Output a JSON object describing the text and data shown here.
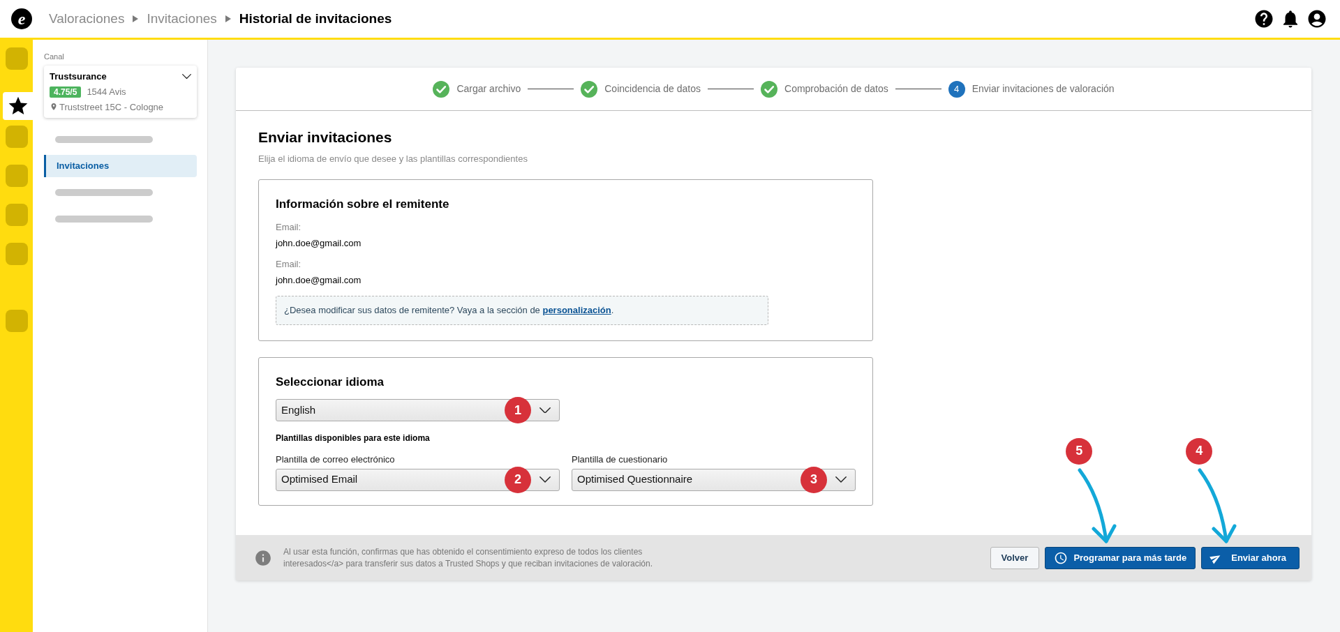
{
  "header": {
    "logo_letter": "e",
    "breadcrumb": [
      {
        "label": "Valoraciones",
        "current": false
      },
      {
        "label": "Invitaciones",
        "current": false
      },
      {
        "label": "Historial de invitaciones",
        "current": true
      }
    ]
  },
  "rail": [
    {
      "kind": "blank",
      "selected": false
    },
    {
      "kind": "star",
      "selected": true
    },
    {
      "kind": "blank",
      "selected": false
    },
    {
      "kind": "blank",
      "selected": false
    },
    {
      "kind": "blank",
      "selected": false
    },
    {
      "kind": "blank",
      "selected": false
    },
    {
      "kind": "gap"
    },
    {
      "kind": "blank",
      "selected": false
    }
  ],
  "channel": {
    "label": "Canal",
    "name": "Trustsurance",
    "rating": "4.75/5",
    "reviews": "1544 Avis",
    "address": "Truststreet 15C - Cologne"
  },
  "nav": [
    {
      "kind": "skeleton"
    },
    {
      "kind": "item",
      "label": "Invitaciones",
      "selected": true
    },
    {
      "kind": "skeleton"
    },
    {
      "kind": "skeleton"
    }
  ],
  "steps": [
    {
      "label": "Cargar archivo",
      "completed": true
    },
    {
      "label": "Coincidencia de datos",
      "completed": true
    },
    {
      "label": "Comprobación de datos",
      "completed": true
    },
    {
      "label": "Enviar invitaciones de valoración",
      "completed": false,
      "number": "4"
    }
  ],
  "page": {
    "title": "Enviar invitaciones",
    "subtitle": "Elija el idioma de envío que desee y las plantillas correspondientes"
  },
  "sender": {
    "title": "Información sobre el remitente",
    "fields": [
      {
        "label": "Email:",
        "value": "john.doe@gmail.com"
      },
      {
        "label": "Email:",
        "value": "john.doe@gmail.com"
      }
    ],
    "notice_before": "¿Desea modificar sus datos de remitente? Vaya a la sección de ",
    "notice_link": "personalización",
    "notice_after": "."
  },
  "language": {
    "title": "Seleccionar idioma",
    "select": {
      "value": "English",
      "badge": "1"
    },
    "templates_title": "Plantillas disponibles para este idioma",
    "templates": [
      {
        "label": "Plantilla de correo electrónico",
        "value": "Optimised Email",
        "badge": "2"
      },
      {
        "label": "Plantilla de cuestionario",
        "value": "Optimised Questionnaire",
        "badge": "3"
      }
    ]
  },
  "footer": {
    "notice": "Al usar esta función, confirmas que has obtenido el consentimiento expreso de todos los clientes interesados</a> para transferir sus datos a Trusted Shops y que reciban invitaciones de valoración.",
    "buttons": [
      {
        "kind": "back",
        "label": "Volver"
      },
      {
        "kind": "schedule",
        "label": "Programar para más tarde",
        "badge": "5"
      },
      {
        "kind": "send",
        "label": "Enviar ahora",
        "badge": "4"
      }
    ]
  }
}
